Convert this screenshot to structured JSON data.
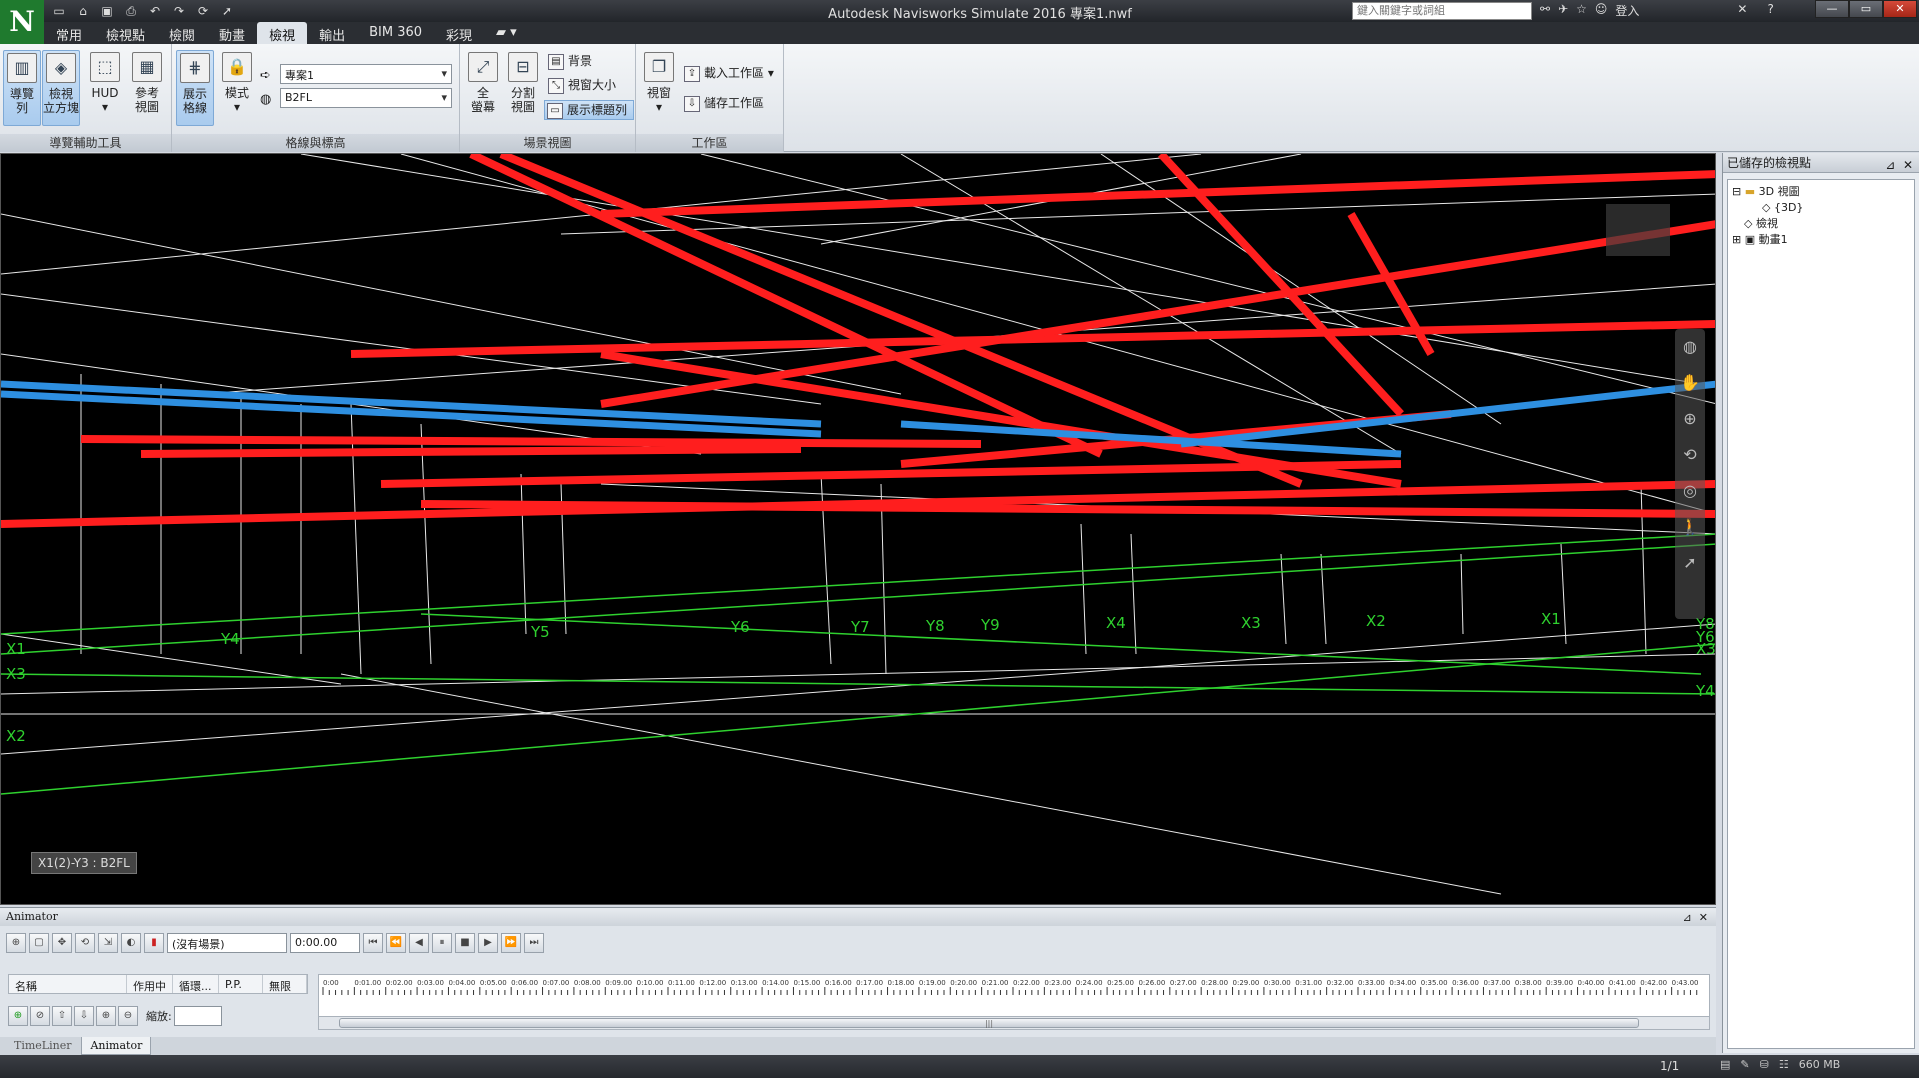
{
  "window": {
    "title": "Autodesk Navisworks Simulate 2016    專案1.nwf",
    "logo": "N"
  },
  "qat": [
    "new-icon",
    "open-icon",
    "save-icon",
    "print-icon",
    "undo-icon",
    "redo-icon",
    "refresh-icon",
    "select-icon"
  ],
  "help_search": {
    "placeholder": "鍵入關鍵字或詞組"
  },
  "title_tools": {
    "signin": "登入"
  },
  "tabs": [
    "常用",
    "檢視點",
    "檢閱",
    "動畫",
    "檢視",
    "輸出",
    "BIM 360",
    "彩現"
  ],
  "active_tab": "檢視",
  "ribbon": {
    "nav_panel": {
      "label": "導覽輔助工具",
      "buttons": [
        {
          "label1": "導覽",
          "label2": "列"
        },
        {
          "label1": "檢視",
          "label2": "立方塊"
        },
        {
          "label1": "HUD",
          "label2": ""
        },
        {
          "label1": "參考",
          "label2": "視圖"
        }
      ]
    },
    "grid_panel": {
      "label": "格線與標高",
      "show_grid": {
        "label1": "展示",
        "label2": "格線"
      },
      "mode": {
        "label1": "模式",
        "label2": ""
      },
      "model_combo": "專案1",
      "level_combo": "B2FL"
    },
    "scene_panel": {
      "label": "場景視圖",
      "fullscreen": {
        "label1": "全",
        "label2": "螢幕"
      },
      "split": {
        "label1": "分割",
        "label2": "視圖"
      },
      "background": "背景",
      "window_size": "視窗大小",
      "show_titlebar": "展示標題列"
    },
    "workspace_panel": {
      "label": "工作區",
      "windows": {
        "label1": "視窗",
        "label2": ""
      },
      "load_workspace": "載入工作區",
      "save_workspace": "儲存工作區"
    }
  },
  "viewport": {
    "status_label": "X1(2)-Y3 : B2FL",
    "grid_labels": [
      "X1",
      "X3",
      "X2",
      "Y4",
      "Y5",
      "Y6",
      "Y7",
      "Y8",
      "Y9",
      "X4",
      "X3",
      "X2",
      "X1",
      "Y8",
      "Y6",
      "X3",
      "Y4"
    ]
  },
  "saved_viewpoints": {
    "title": "已儲存的檢視點",
    "tree": [
      {
        "label": "3D 視圖",
        "level": 0,
        "icon": "folder-icon"
      },
      {
        "label": "{3D}",
        "level": 1,
        "icon": "cube-view-icon"
      },
      {
        "label": "檢視",
        "level": 0,
        "icon": "viewpoint-icon"
      },
      {
        "label": "動畫1",
        "level": 0,
        "icon": "animation-icon"
      }
    ]
  },
  "animator": {
    "title": "Animator",
    "scene_combo": "(沒有場景)",
    "time_value": "0:00.00",
    "columns": [
      "名稱",
      "作用中",
      "循環...",
      "P.P.",
      "無限"
    ],
    "zoom_label": "縮放:",
    "timeline_ticks": [
      "0:00",
      "0:01.00",
      "0:02.00",
      "0:03.00",
      "0:04.00",
      "0:05.00",
      "0:06.00",
      "0:07.00",
      "0:08.00",
      "0:09.00",
      "0:10.00",
      "0:11.00",
      "0:12.00",
      "0:13.00",
      "0:14.00",
      "0:15.00",
      "0:16.00",
      "0:17.00",
      "0:18.00",
      "0:19.00",
      "0:20.00",
      "0:21.00",
      "0:22.00",
      "0:23.00",
      "0:24.00",
      "0:25.00",
      "0:26.00",
      "0:27.00",
      "0:28.00",
      "0:29.00",
      "0:30.00",
      "0:31.00",
      "0:32.00",
      "0:33.00",
      "0:34.00",
      "0:35.00",
      "0:36.00",
      "0:37.00",
      "0:38.00",
      "0:39.00",
      "0:40.00",
      "0:41.00",
      "0:42.00",
      "0:43.00"
    ]
  },
  "bottom_tabs": [
    "TimeLiner",
    "Animator"
  ],
  "active_bottom_tab": "Animator",
  "statusbar": {
    "pages": "1/1",
    "memory": "660 MB"
  },
  "colors": {
    "pipe_red": "#ff1e1e",
    "pipe_blue": "#2e8fe0",
    "grid_green": "#2fd12f",
    "wire_white": "#e8e8e8"
  }
}
